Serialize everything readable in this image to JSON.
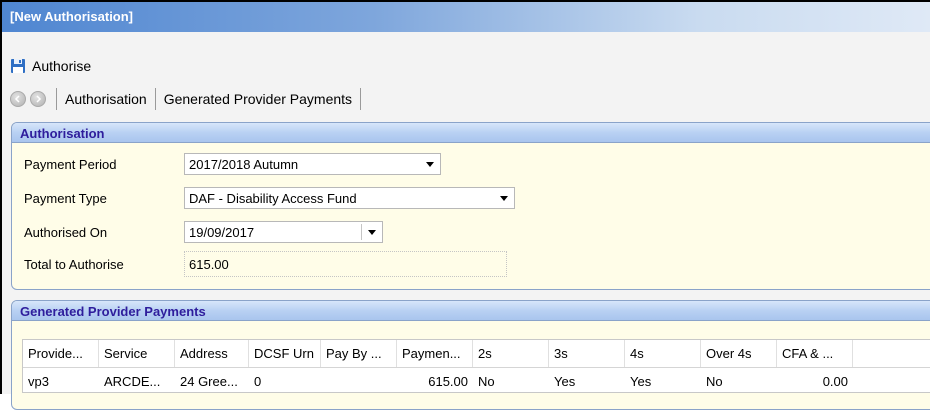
{
  "window": {
    "title": "[New Authorisation]"
  },
  "toolbar": {
    "save_label": "Authorise"
  },
  "nav": {
    "links": [
      "Authorisation",
      "Generated Provider Payments"
    ]
  },
  "authorisation": {
    "header": "Authorisation",
    "payment_period": {
      "label": "Payment Period",
      "value": "2017/2018 Autumn"
    },
    "payment_type": {
      "label": "Payment Type",
      "value": "DAF - Disability Access Fund"
    },
    "authorised_on": {
      "label": "Authorised On",
      "value": "19/09/2017"
    },
    "total": {
      "label": "Total to Authorise",
      "value": "615.00"
    }
  },
  "payments": {
    "header": "Generated Provider Payments",
    "columns": [
      "Provide...",
      "Service",
      "Address",
      "DCSF Urn",
      "Pay By ...",
      "Paymen...",
      "2s",
      "3s",
      "4s",
      "Over 4s",
      "CFA & ..."
    ],
    "rows": [
      [
        "vp3",
        "ARCDE...",
        "24 Gree...",
        "0",
        "",
        "615.00",
        "No",
        "Yes",
        "Yes",
        "No",
        "0.00"
      ]
    ]
  },
  "colors": {
    "title_bar": "#4f86d1",
    "panel_header_text": "#2e1d9c",
    "panel_background": "#fffde8"
  },
  "icons": [
    "save-icon",
    "back-icon",
    "forward-icon",
    "dropdown-arrow-icon"
  ]
}
